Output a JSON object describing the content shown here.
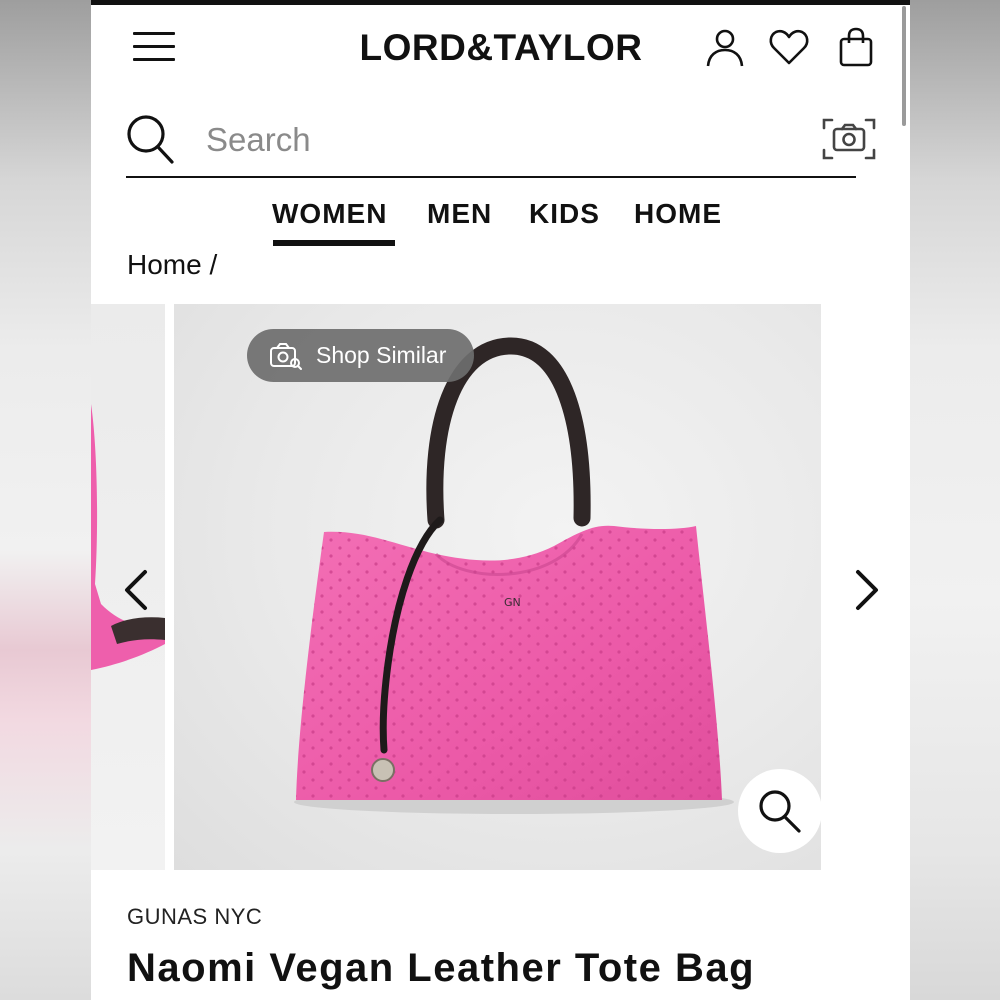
{
  "header": {
    "logo_text": "LORD&TAYLOR",
    "icons": [
      "menu-icon",
      "account-icon",
      "wishlist-heart-icon",
      "shopping-bag-icon"
    ]
  },
  "search": {
    "placeholder": "Search",
    "value": "",
    "icons": [
      "search-icon",
      "camera-search-icon"
    ]
  },
  "nav": {
    "tabs": [
      {
        "label": "WOMEN",
        "active": true
      },
      {
        "label": "MEN",
        "active": false
      },
      {
        "label": "KIDS",
        "active": false
      },
      {
        "label": "HOME",
        "active": false
      }
    ]
  },
  "breadcrumb": {
    "text": "Home /"
  },
  "gallery": {
    "shop_similar_label": "Shop Similar",
    "product_color": "#ee5fac",
    "controls": [
      "chevron-left-icon",
      "chevron-right-icon",
      "zoom-magnifier-icon"
    ]
  },
  "product": {
    "brand": "GUNAS NYC",
    "title": "Naomi Vegan Leather Tote Bag"
  }
}
